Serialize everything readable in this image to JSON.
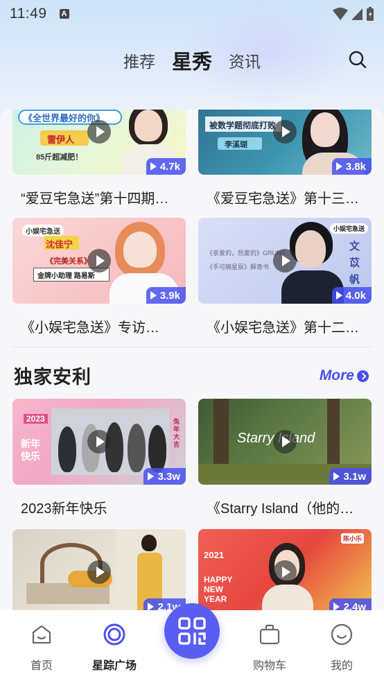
{
  "status_bar": {
    "time": "11:49",
    "notification_letter": "A"
  },
  "header": {
    "tabs": [
      {
        "label": "推荐",
        "active": false
      },
      {
        "label": "星秀",
        "active": true
      },
      {
        "label": "资讯",
        "active": false
      }
    ],
    "search_icon": "search-icon"
  },
  "videos_top": [
    {
      "title": "“爱豆宅急送”第十四期…",
      "views": "4.7k",
      "thumb_text": [
        "《全世界最好的你》",
        "雷伊人",
        "85斤超减肥！"
      ]
    },
    {
      "title": "《爱豆宅急送》第十三期…",
      "views": "3.8k",
      "thumb_text": [
        "被数学题彻底打败",
        "李溪瑚"
      ]
    },
    {
      "title": "《小娱宅急送》专访…",
      "views": "3.9k",
      "thumb_text": [
        "小娱宅急送",
        "沈佳宁",
        "《完美关系》",
        "金牌小助理 路易斯"
      ]
    },
    {
      "title": "《小娱宅急送》第十二期…",
      "views": "4.0k",
      "thumb_text": [
        "小娱宅急送",
        "《亲爱的，热爱的》GRUNT",
        "《手可摘星辰》解青书",
        "文苡帆"
      ]
    }
  ],
  "section": {
    "title": "独家安利",
    "more_label": "More"
  },
  "videos_bottom": [
    {
      "title": "2023新年快乐",
      "views": "3.3w",
      "thumb_text": [
        "2023",
        "新年快乐",
        "兔年大吉"
      ]
    },
    {
      "title": "《Starry Island（他的小岛）》",
      "views": "3.1w",
      "thumb_text": [
        "Starry Island"
      ]
    },
    {
      "title": "",
      "views": "2.1w",
      "thumb_text": []
    },
    {
      "title": "",
      "views": "2.4w",
      "thumb_text": [
        "2021",
        "HAPPY NEW YEAR",
        "陈小乐"
      ]
    }
  ],
  "bottom_nav": [
    {
      "label": "首页",
      "icon": "home-icon",
      "active": false
    },
    {
      "label": "星踪广场",
      "icon": "target-icon",
      "active": true
    },
    {
      "label": "",
      "icon": "qr-code-icon",
      "active": false
    },
    {
      "label": "购物车",
      "icon": "bag-icon",
      "active": false
    },
    {
      "label": "我的",
      "icon": "smile-icon",
      "active": false
    }
  ],
  "colors": {
    "accent": "#4a4ef0",
    "views_badge": "#4650f0",
    "scan_button": "#5a5df2"
  }
}
